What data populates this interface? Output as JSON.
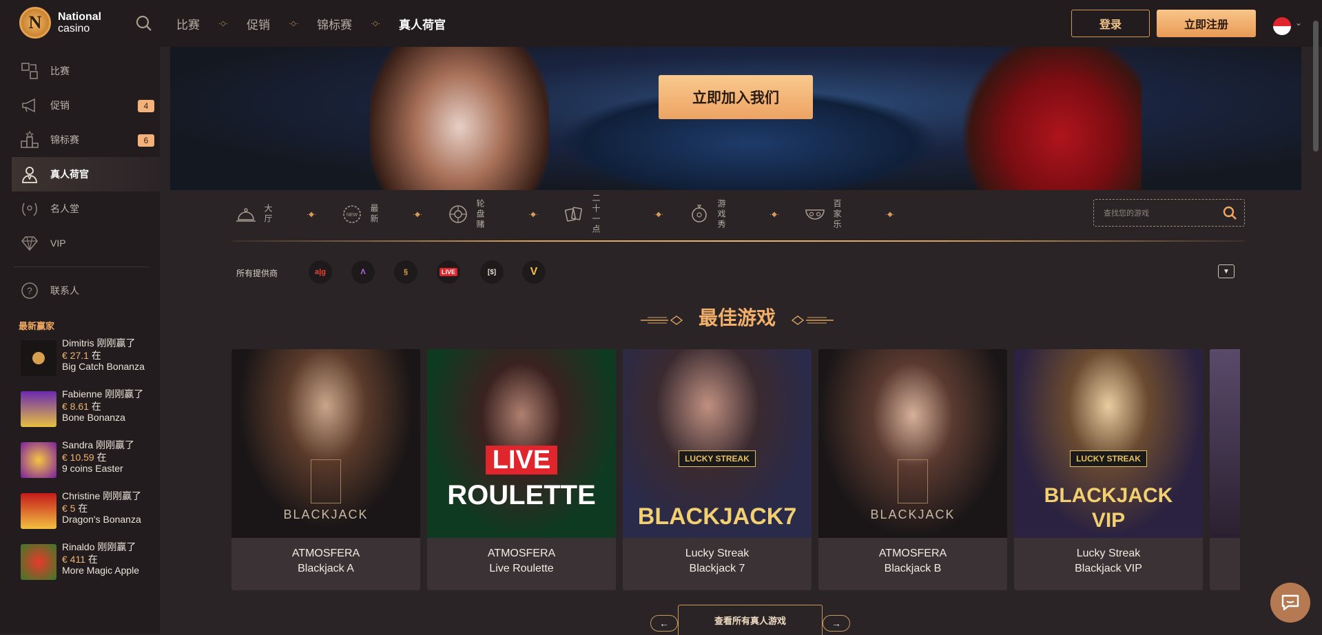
{
  "brand": {
    "line1": "National",
    "line2": "casino",
    "badge": "N"
  },
  "nav": {
    "items": [
      "比赛",
      "促销",
      "锦标赛",
      "真人荷官"
    ],
    "active_index": 3
  },
  "header": {
    "login": "登录",
    "register": "立即注册",
    "language_flag": "sg-flag"
  },
  "sidebar": {
    "items": [
      {
        "label": "比赛",
        "icon": "puzzle-icon"
      },
      {
        "label": "促销",
        "icon": "megaphone-icon",
        "badge": "4"
      },
      {
        "label": "锦标赛",
        "icon": "podium-icon",
        "badge": "6"
      },
      {
        "label": "真人荷官",
        "icon": "dealer-icon",
        "active": true
      },
      {
        "label": "名人堂",
        "icon": "laurel-icon"
      },
      {
        "label": "VIP",
        "icon": "diamond-icon"
      },
      {
        "label": "联系人",
        "icon": "help-icon"
      }
    ],
    "winners_title": "最新赢家",
    "winners": [
      {
        "line1": "Dimitris 刚刚赢了",
        "amount": "€ 27.1",
        "at": "在",
        "game": "Big Catch Bonanza"
      },
      {
        "line1": "Fabienne 刚刚赢了",
        "amount": "€ 8.61",
        "at": "在",
        "game": "Bone Bonanza"
      },
      {
        "line1": "Sandra 刚刚赢了",
        "amount": "€ 10.59",
        "at": "在",
        "game": "9 coins Easter"
      },
      {
        "line1": "Christine 刚刚赢了",
        "amount": "€ 5",
        "at": "在",
        "game": "Dragon's Bonanza"
      },
      {
        "line1": "Rinaldo 刚刚赢了",
        "amount": "€ 411",
        "at": "在",
        "game": "More Magic Apple"
      }
    ]
  },
  "hero": {
    "cta": "立即加入我们"
  },
  "categories": [
    {
      "label": "大厅",
      "icon": "bell-icon"
    },
    {
      "label": "最新",
      "icon": "new-badge-icon"
    },
    {
      "label": "轮盘赌",
      "icon": "roulette-icon"
    },
    {
      "label": "二十一点",
      "icon": "cards-icon"
    },
    {
      "label": "游戏秀",
      "icon": "gameshow-icon"
    },
    {
      "label": "百家乐",
      "icon": "baccarat-icon"
    }
  ],
  "search": {
    "placeholder": "查找您的游戏"
  },
  "providers": {
    "label": "所有提供商",
    "items": [
      "a|g",
      "Λ",
      "§",
      "LIVE",
      "[$]",
      "V"
    ]
  },
  "best_games": {
    "title": "最佳游戏",
    "cards": [
      {
        "provider": "ATMOSFERA",
        "name": "Blackjack A",
        "art_text": "BLACKJACK"
      },
      {
        "provider": "ATMOSFERA",
        "name": "Live Roulette",
        "art_text": "ROULETTE",
        "art_text2": "LIVE"
      },
      {
        "provider": "Lucky Streak",
        "name": "Blackjack 7",
        "art_text": "BLACKJACK7",
        "art_text2": "LUCKY STREAK"
      },
      {
        "provider": "ATMOSFERA",
        "name": "Blackjack B",
        "art_text": "BLACKJACK"
      },
      {
        "provider": "Lucky Streak",
        "name": "Blackjack VIP",
        "art_text": "BLACKJACK",
        "art_text2": "LUCKY STREAK",
        "art_text3": "VIP"
      }
    ]
  },
  "pager": {
    "view_all": "查看所有真人游戏",
    "prev": "←",
    "next": "→"
  },
  "colors": {
    "accent": "#eda363",
    "background": "#2a2426",
    "panel": "#221c1e",
    "gold": "#d49a58"
  }
}
